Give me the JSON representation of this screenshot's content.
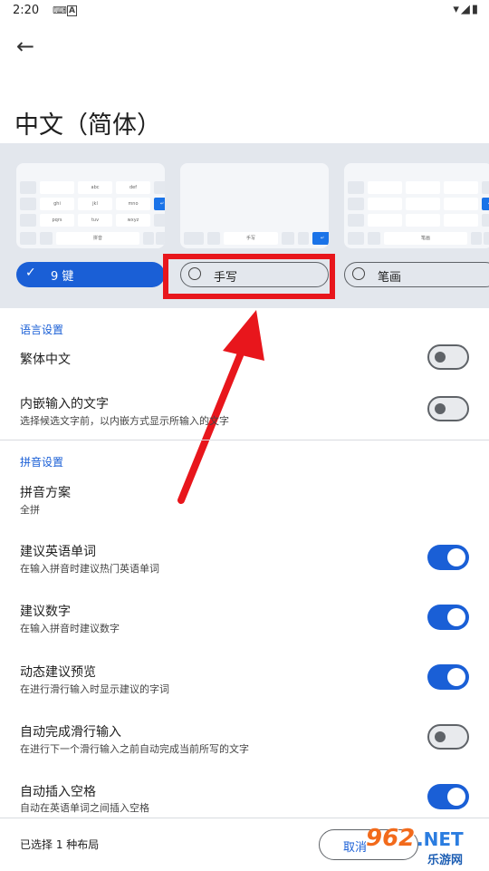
{
  "status_bar": {
    "time": "2:20"
  },
  "header": {
    "title": "中文（简体）"
  },
  "layouts": [
    {
      "label": "9 键",
      "selected": true
    },
    {
      "label": "手写",
      "selected": false
    },
    {
      "label": "笔画",
      "selected": false
    }
  ],
  "keyboard_preview": {
    "k9_keys": [
      "abc",
      "def",
      "ghi",
      "jkl",
      "mno",
      "pqrs",
      "tuv",
      "wxyz",
      "拼音"
    ],
    "hw_key": "手写",
    "stroke_key": "笔画"
  },
  "sections": {
    "language": {
      "header": "语言设置",
      "traditional": {
        "title": "繁体中文",
        "on": false
      },
      "inline": {
        "title": "内嵌输入的文字",
        "subtitle": "选择候选文字前，以内嵌方式显示所输入的文字",
        "on": false
      }
    },
    "pinyin": {
      "header": "拼音设置",
      "scheme": {
        "title": "拼音方案",
        "subtitle": "全拼"
      },
      "english": {
        "title": "建议英语单词",
        "subtitle": "在输入拼音时建议热门英语单词",
        "on": true
      },
      "numbers": {
        "title": "建议数字",
        "subtitle": "在输入拼音时建议数字",
        "on": true
      },
      "preview": {
        "title": "动态建议预览",
        "subtitle": "在进行滑行输入时显示建议的字词",
        "on": true
      },
      "autocomplete": {
        "title": "自动完成滑行输入",
        "subtitle": "在进行下一个滑行输入之前自动完成当前所写的文字",
        "on": false
      },
      "space": {
        "title": "自动插入空格",
        "subtitle": "自动在英语单词之间插入空格",
        "on": true
      }
    }
  },
  "footer": {
    "selected_count": "已选择 1 种布局",
    "cancel_label": "取消"
  },
  "watermark": {
    "text1": "962",
    "text2": ".NET",
    "text3": "乐游网"
  },
  "colors": {
    "accent": "#1a5fd6",
    "annotation_red": "#e8161c",
    "toggle_off": "#5f6368"
  }
}
